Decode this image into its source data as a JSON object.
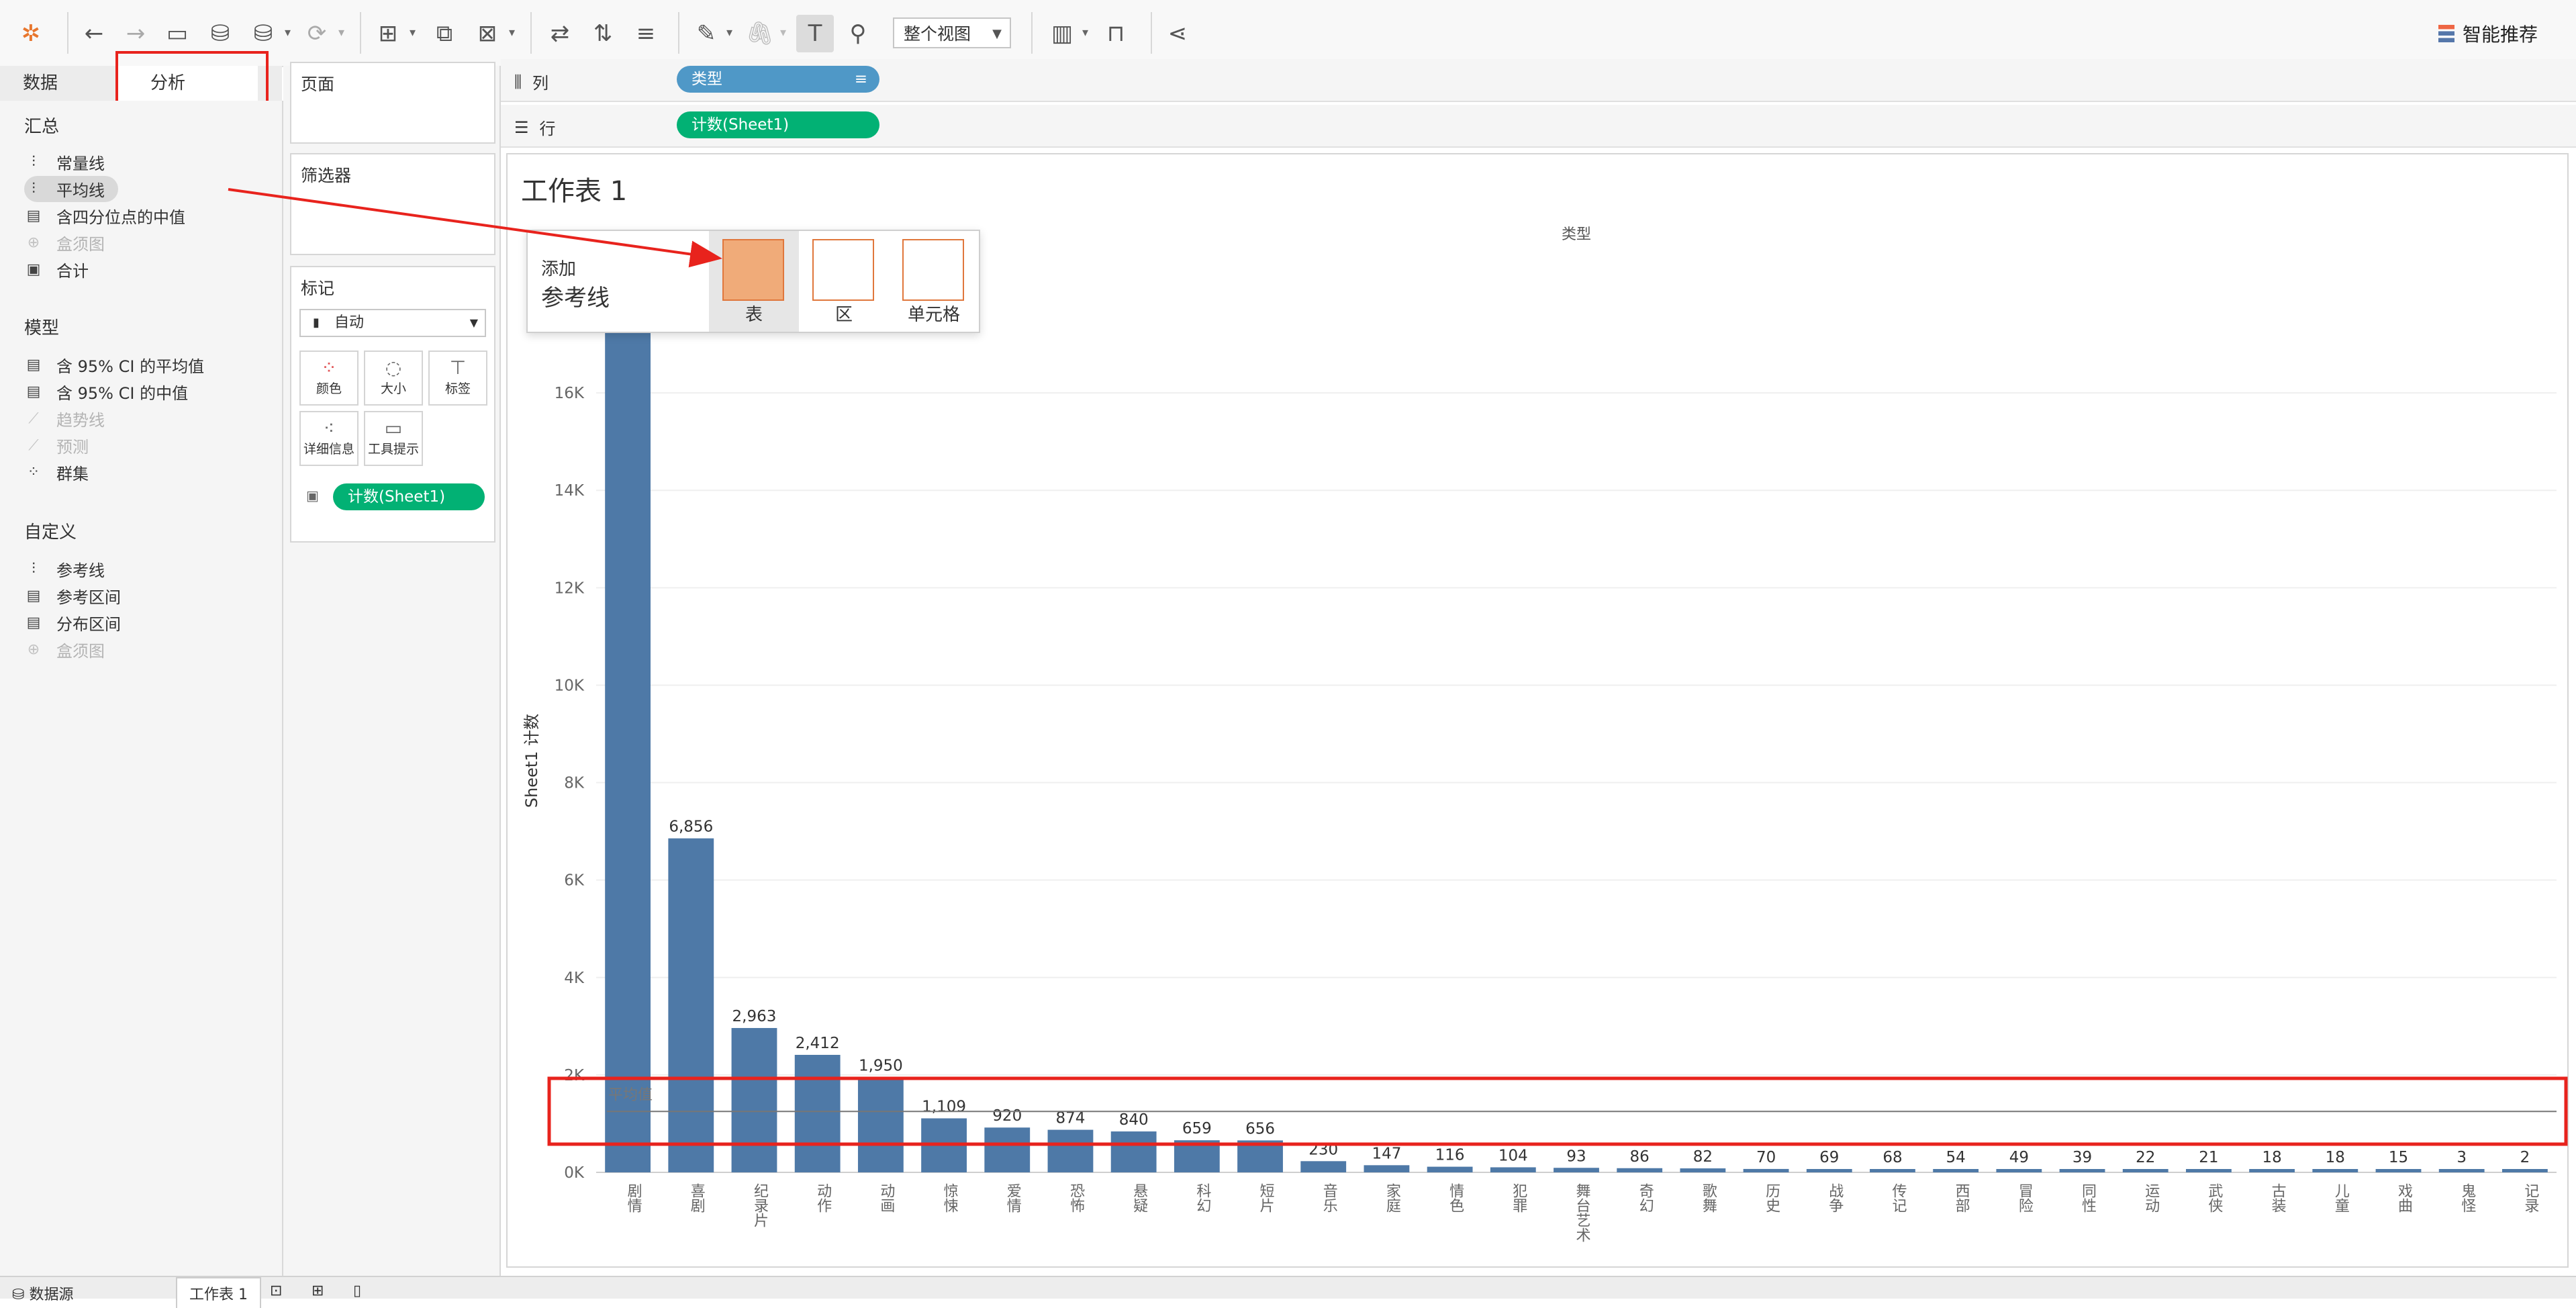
{
  "toolbar": {
    "fit_view_label": "整个视图",
    "smart_recommend_label": "智能推荐"
  },
  "left_tabs": {
    "data_label": "数据",
    "analysis_label": "分析"
  },
  "analysis": {
    "summary_title": "汇总",
    "summary_items": [
      {
        "label": "常量线",
        "disabled": false
      },
      {
        "label": "平均线",
        "disabled": false,
        "highlighted": true
      },
      {
        "label": "含四分位点的中值",
        "disabled": false
      },
      {
        "label": "盒须图",
        "disabled": true
      },
      {
        "label": "合计",
        "disabled": false
      }
    ],
    "model_title": "模型",
    "model_items": [
      {
        "label": "含 95% CI 的平均值",
        "disabled": false
      },
      {
        "label": "含 95% CI 的中值",
        "disabled": false
      },
      {
        "label": "趋势线",
        "disabled": true
      },
      {
        "label": "预测",
        "disabled": true
      },
      {
        "label": "群集",
        "disabled": false
      }
    ],
    "custom_title": "自定义",
    "custom_items": [
      {
        "label": "参考线",
        "disabled": false
      },
      {
        "label": "参考区间",
        "disabled": false
      },
      {
        "label": "分布区间",
        "disabled": false
      },
      {
        "label": "盒须图",
        "disabled": true
      }
    ]
  },
  "cards": {
    "pages_title": "页面",
    "filters_title": "筛选器",
    "marks_title": "标记",
    "marks_type": "自动",
    "marks_buttons": [
      "颜色",
      "大小",
      "标签",
      "详细信息",
      "工具提示"
    ],
    "marks_pill": "计数(Sheet1)"
  },
  "shelves": {
    "columns_label": "列",
    "columns_pill": "类型",
    "rows_label": "行",
    "rows_pill": "计数(Sheet1)"
  },
  "view": {
    "title": "工作表 1"
  },
  "ref_popup": {
    "line1": "添加",
    "line2": "参考线",
    "options": [
      "表",
      "区",
      "单元格"
    ],
    "active": 0
  },
  "statusbar": {
    "datasource_label": "数据源",
    "sheet_tab": "工作表 1"
  },
  "colors": {
    "bar": "#4e79a7",
    "highlight": "#e8231d",
    "pill_green": "#02b174",
    "pill_blue": "#4f98c7"
  },
  "chart_data": {
    "type": "bar",
    "column_header": "类型",
    "ylabel": "Sheet1 计数",
    "reference_line_label": "平均值",
    "reference_line_value": 1250,
    "ylim": [
      0,
      18000
    ],
    "yticks": [
      "0K",
      "2K",
      "4K",
      "6K",
      "8K",
      "10K",
      "12K",
      "14K",
      "16K"
    ],
    "categories": [
      "剧情",
      "喜剧",
      "纪录片",
      "动作",
      "动画",
      "惊悚",
      "爱情",
      "恐怖",
      "悬疑",
      "科幻",
      "短片",
      "音乐",
      "家庭",
      "情色",
      "犯罪",
      "舞台艺术",
      "奇幻",
      "歌舞",
      "历史",
      "战争",
      "传记",
      "西部",
      "冒险",
      "同性",
      "运动",
      "武侠",
      "古装",
      "儿童",
      "戏曲",
      "鬼怪",
      "记录"
    ],
    "values": [
      18000,
      6856,
      2963,
      2412,
      1950,
      1109,
      920,
      874,
      840,
      659,
      656,
      230,
      147,
      116,
      104,
      93,
      86,
      82,
      70,
      69,
      68,
      54,
      49,
      39,
      22,
      21,
      18,
      18,
      15,
      3,
      2
    ],
    "value_labels": [
      "",
      "6,856",
      "2,963",
      "2,412",
      "1,950",
      "1,109",
      "920",
      "874",
      "840",
      "659",
      "656",
      "230",
      "147",
      "116",
      "104",
      "93",
      "86",
      "82",
      "70",
      "69",
      "68",
      "54",
      "49",
      "39",
      "22",
      "21",
      "18",
      "18",
      "15",
      "3",
      "2"
    ]
  }
}
